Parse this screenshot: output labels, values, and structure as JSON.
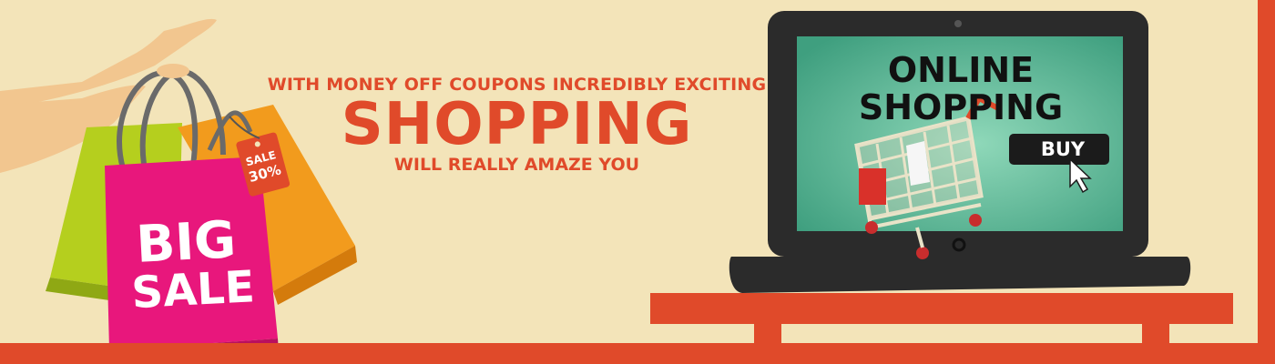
{
  "headline": {
    "line1": "WITH MONEY OFF COUPONS INCREDIBLY EXCITING",
    "line2": "SHOPPING",
    "line3": "WILL REALLY AMAZE YOU"
  },
  "bags": {
    "bag_text_line1": "BIG",
    "bag_text_line2": "SALE",
    "tag_line1": "SALE",
    "tag_line2": "30%"
  },
  "laptop": {
    "screen_title_line1": "ONLINE",
    "screen_title_line2": "SHOPPING",
    "buy_label": "BUY"
  },
  "colors": {
    "background": "#f3e4b9",
    "accent": "#e04a2a",
    "bag_pink": "#e8177c",
    "bag_green": "#b5cf1e",
    "bag_orange": "#f29b1d",
    "screen": "#55b495",
    "laptop_body": "#2b2b2b"
  }
}
